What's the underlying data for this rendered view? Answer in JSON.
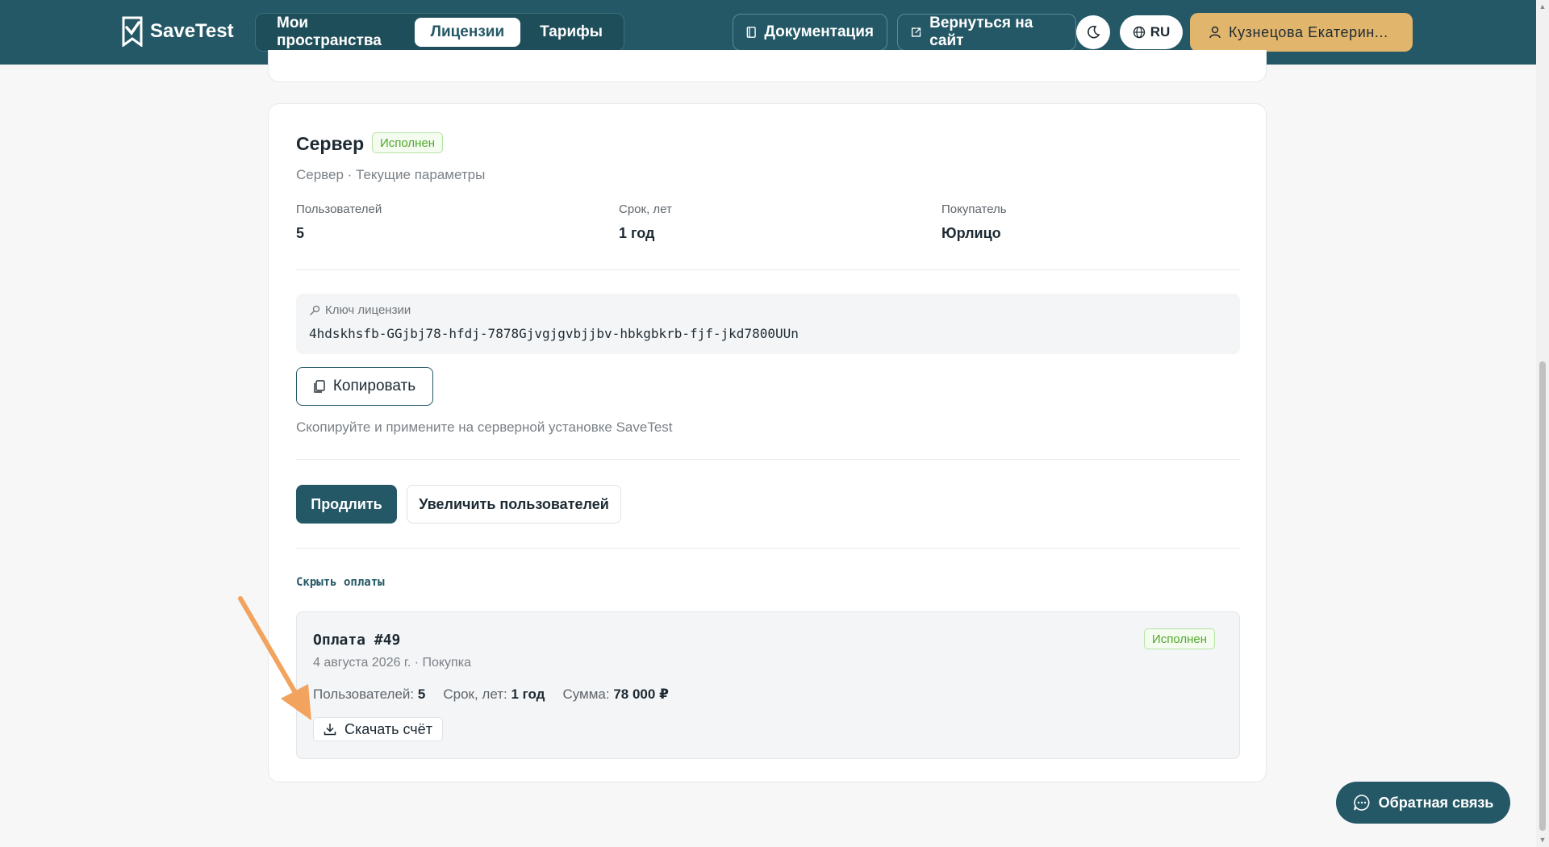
{
  "header": {
    "logo": "SaveTest",
    "nav": [
      "Мои пространства",
      "Лицензии",
      "Тарифы"
    ],
    "active_nav": "Лицензии",
    "docs": "Документация",
    "back": "Вернуться на сайт",
    "lang": "RU",
    "user": "Кузнецова Екатерин..."
  },
  "license": {
    "title": "Сервер",
    "status": "Исполнен",
    "subtitle": "Сервер · Текущие параметры",
    "fields": [
      {
        "label": "Пользователей",
        "value": "5"
      },
      {
        "label": "Срок, лет",
        "value": "1 год"
      },
      {
        "label": "Покупатель",
        "value": "Юрлицо"
      }
    ],
    "key_label": "Ключ лицензии",
    "key_value": "4hdskhsfb-GGjbj78-hfdj-7878Gjvgjgvbjjbv-hbkgbkrb-fjf-jkd7800UUn",
    "copy": "Копировать",
    "hint": "Скопируйте и примените на серверной установке SaveTest",
    "extend": "Продлить",
    "increase": "Увеличить пользователей",
    "hide_payments": "Скрыть оплаты"
  },
  "payment": {
    "title": "Оплата #49",
    "status": "Исполнен",
    "meta": "4 августа 2026 г. · Покупка",
    "users_label": "Пользователей:",
    "users_value": "5",
    "term_label": "Срок, лет:",
    "term_value": "1 год",
    "sum_label": "Сумма:",
    "sum_value": "78 000 ₽",
    "download": "Скачать счёт"
  },
  "feedback": "Обратная связь",
  "colors": {
    "primary": "#245866",
    "accent": "#e1b56c",
    "success": "#52a82f",
    "arrow": "#f2a35e"
  }
}
